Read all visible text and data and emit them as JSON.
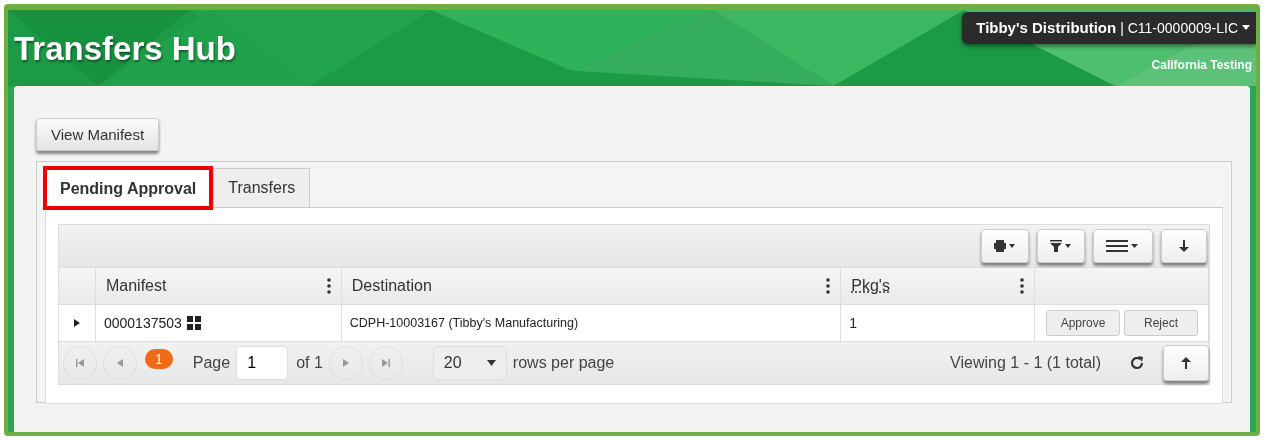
{
  "header": {
    "title": "Transfers Hub",
    "account": {
      "name": "Tibby's Distribution",
      "separator": "|",
      "license": "C11-0000009-LIC"
    },
    "environment": "California Testing"
  },
  "view_manifest_button": "View Manifest",
  "tabs": [
    {
      "label": "Pending Approval",
      "selected": true,
      "highlighted": true
    },
    {
      "label": "Transfers",
      "selected": false,
      "highlighted": false
    }
  ],
  "table": {
    "columns": [
      {
        "label": "Manifest",
        "menu": true
      },
      {
        "label": "Destination",
        "menu": true
      },
      {
        "label": "Pkg's",
        "menu": true
      },
      {
        "menu": false
      }
    ],
    "rows": [
      {
        "expanded": false,
        "manifest": "0000137503",
        "destination": "CDPH-10003167 (Tibby's Manufacturing)",
        "packages": "1",
        "actions": [
          "Approve",
          "Reject"
        ]
      }
    ]
  },
  "pager": {
    "current_page": "1",
    "page_label": "Page",
    "page_value": "1",
    "of_label": "of 1",
    "rows_per_page": "20",
    "rows_label": "rows per page",
    "viewing": "Viewing 1 - 1 (1 total)"
  }
}
